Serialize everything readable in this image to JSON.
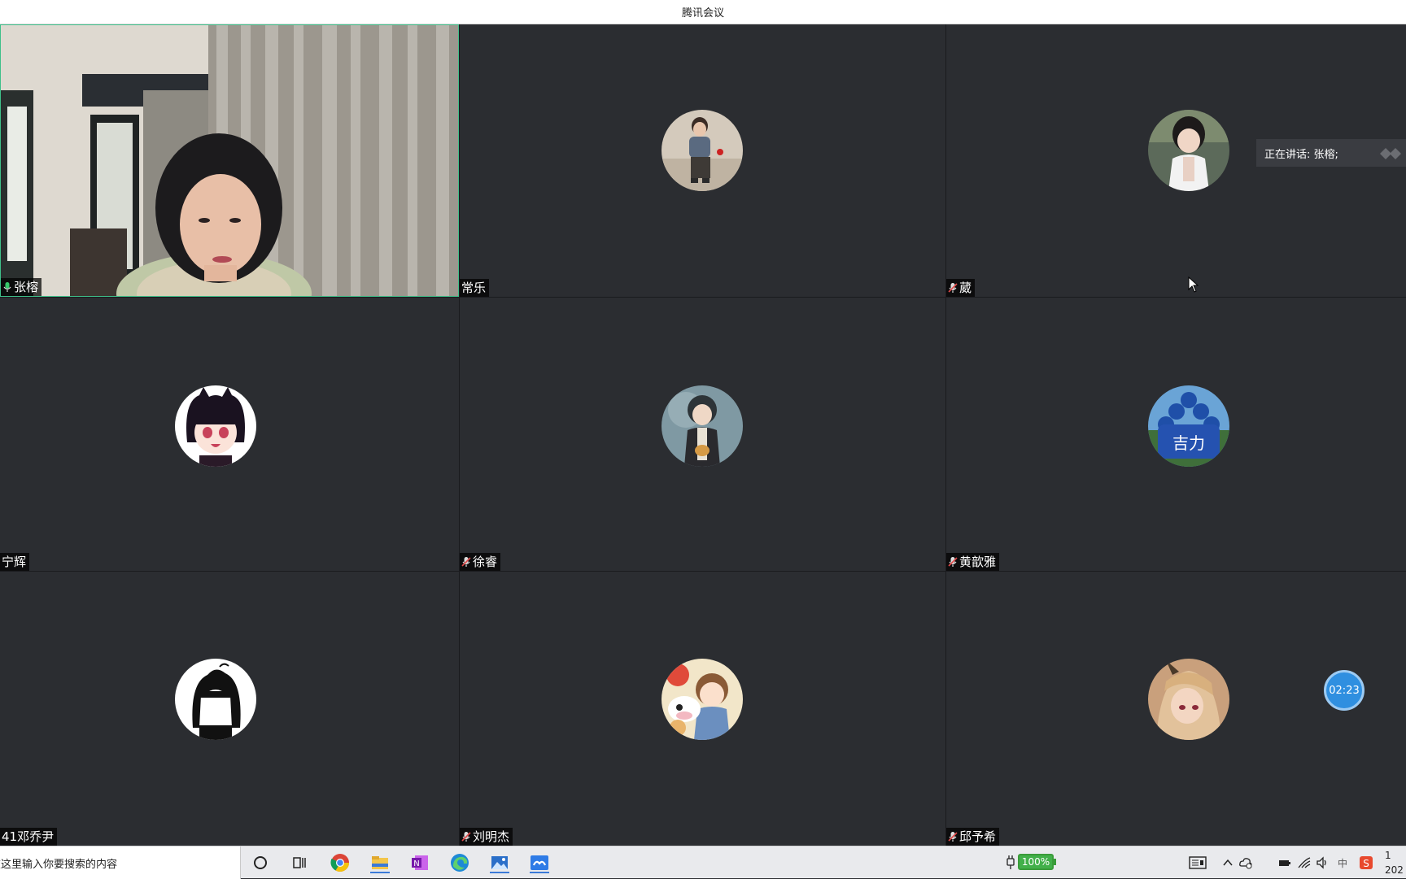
{
  "window": {
    "title": "腾讯会议"
  },
  "participants": [
    {
      "name": "张榕",
      "muted": false,
      "video": true,
      "active": true
    },
    {
      "name": "常乐",
      "muted": false,
      "video": false
    },
    {
      "name": "葳",
      "muted": true,
      "video": false
    },
    {
      "name": "宁辉",
      "muted": false,
      "video": false
    },
    {
      "name": "徐睿",
      "muted": true,
      "video": false
    },
    {
      "name": "黄歆雅",
      "muted": true,
      "video": false
    },
    {
      "name": "41邓乔尹",
      "muted": false,
      "video": false
    },
    {
      "name": "刘明杰",
      "muted": true,
      "video": false
    },
    {
      "name": "邱予希",
      "muted": true,
      "video": false
    }
  ],
  "speaking_indicator": {
    "text": "正在讲话: 张榕;"
  },
  "timer": {
    "text": "02:23"
  },
  "taskbar": {
    "search_placeholder": "在这里输入你要搜索的内容",
    "battery": "100%",
    "apps": [
      "cortana-icon",
      "task-view-icon",
      "chrome-icon",
      "file-explorer-icon",
      "onenote-icon",
      "edge-icon",
      "photos-icon",
      "tencent-meeting-icon"
    ],
    "clock_time": "1",
    "clock_date": "202"
  },
  "colors": {
    "tile_bg": "#2b2d31",
    "active_border": "#3fc08a",
    "timer_bg": "#2f8fe0"
  }
}
